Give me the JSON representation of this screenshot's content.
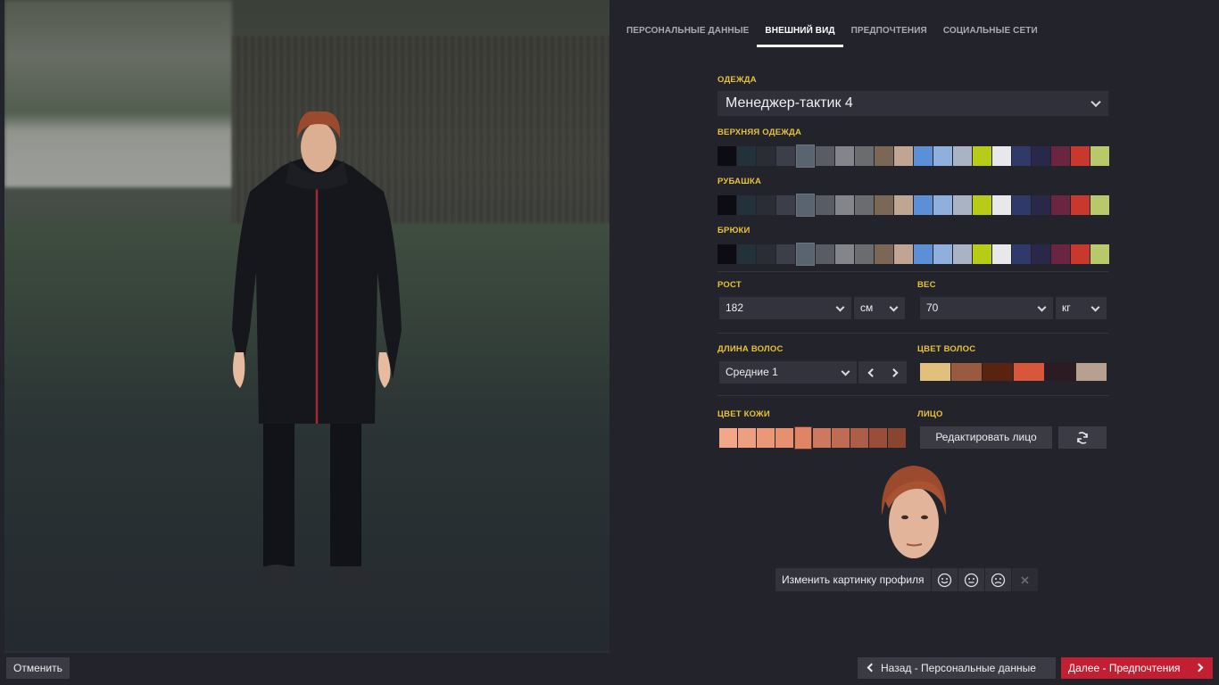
{
  "tabs": [
    {
      "label": "ПЕРСОНАЛЬНЫЕ ДАННЫЕ",
      "active": false
    },
    {
      "label": "ВНЕШНИЙ ВИД",
      "active": true
    },
    {
      "label": "ПРЕДПОЧТЕНИЯ",
      "active": false
    },
    {
      "label": "СОЦИАЛЬНЫЕ СЕТИ",
      "active": false
    }
  ],
  "clothing": {
    "label": "ОДЕЖДА",
    "value": "Менеджер-тактик 4",
    "outerwear_label": "ВЕРХНЯЯ ОДЕЖДА",
    "shirt_label": "РУБАШКА",
    "trousers_label": "БРЮКИ",
    "palette": [
      "#0c0c12",
      "#22313a",
      "#2a2d36",
      "#3c3f4a",
      "#5a6470",
      "#5a5c64",
      "#83858b",
      "#6b6c6e",
      "#7a6756",
      "#c0a592",
      "#5c8fd6",
      "#8fb0dc",
      "#aab3c3",
      "#b8cc17",
      "#e8e8ea",
      "#2f3a6a",
      "#2a2848",
      "#6a2640",
      "#c8382c",
      "#b9c86a"
    ],
    "selected_index": 4
  },
  "height": {
    "label": "РОСТ",
    "value": "182",
    "unit": "см"
  },
  "weight": {
    "label": "ВЕС",
    "value": "70",
    "unit": "кг"
  },
  "hair_length": {
    "label": "ДЛИНА ВОЛОС",
    "value": "Средние 1"
  },
  "hair_color": {
    "label": "ЦВЕТ ВОЛОС",
    "palette": [
      "#e0c07a",
      "#9a5a40",
      "#5a2210",
      "#d8563a",
      "#2a1c22",
      "#b8a090"
    ]
  },
  "skin_color": {
    "label": "ЦВЕТ КОЖИ",
    "palette": [
      "#f2a888",
      "#ee9f80",
      "#ea9878",
      "#e69070",
      "#e08466",
      "#cf7860",
      "#c06c54",
      "#ac5e48",
      "#9a4e3a",
      "#8a4432"
    ],
    "selected_index": 4
  },
  "face": {
    "label": "ЛИЦО",
    "edit_label": "Редактировать лицо"
  },
  "profile": {
    "change_label": "Изменить картинку профиля"
  },
  "footer": {
    "cancel_label": "Отменить",
    "back_label": "Назад - Персональные данные",
    "next_label": "Далее - Предпочтения"
  }
}
